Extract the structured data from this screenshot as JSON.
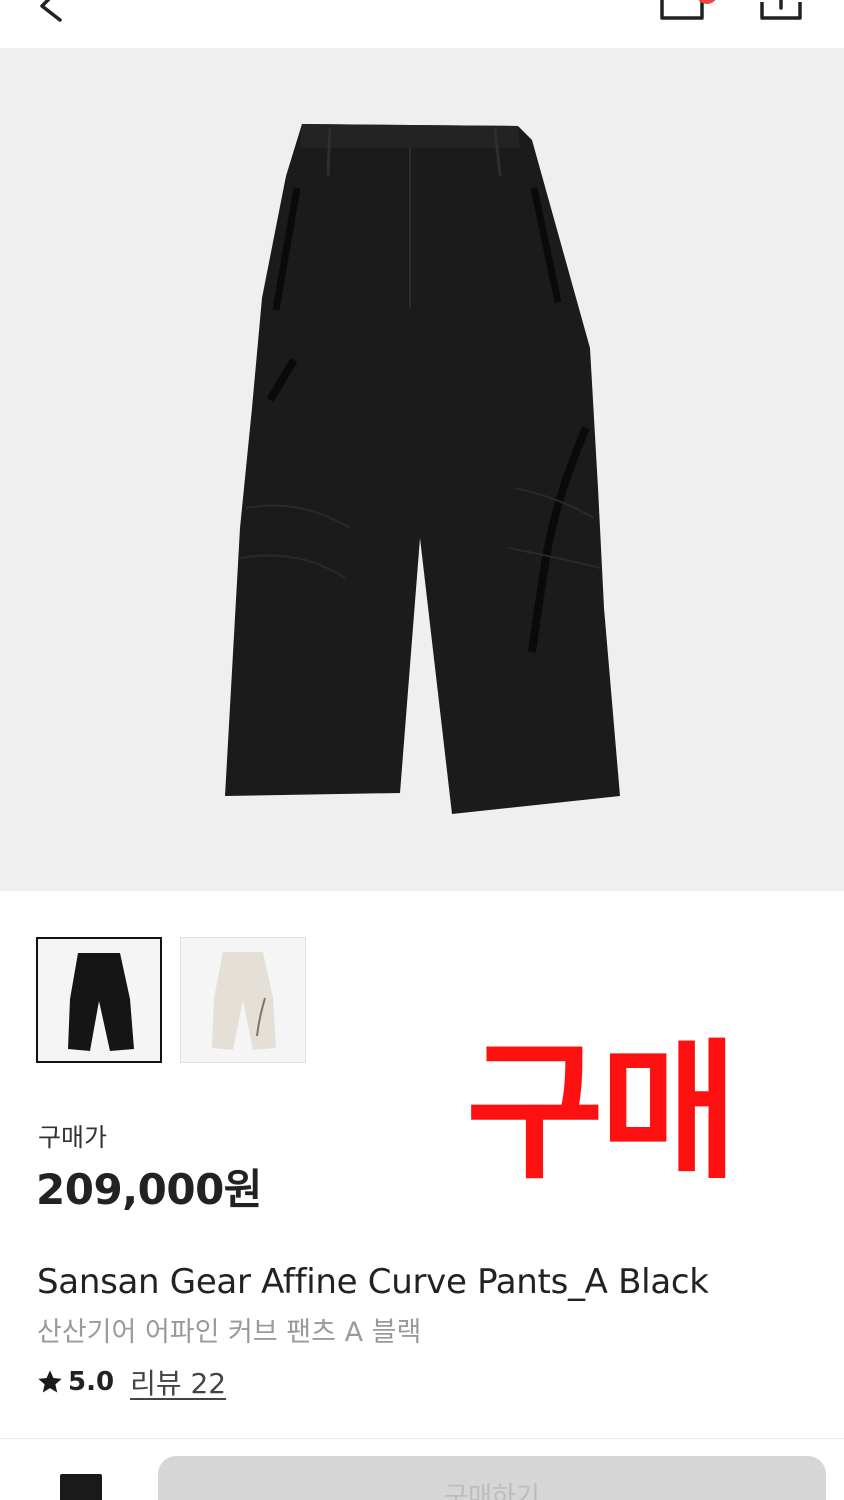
{
  "header": {
    "back_icon": "chevron-left-icon",
    "cart_icon": "shopping-bag-icon",
    "share_icon": "share-icon",
    "badge_color": "#ef4444"
  },
  "product": {
    "image": "black-pants",
    "thumbnails": [
      {
        "label": "black",
        "selected": true
      },
      {
        "label": "ivory",
        "selected": false
      }
    ],
    "price_label": "구매가",
    "price": "209,000원",
    "name_en": "Sansan Gear Affine Curve Pants_A Black",
    "name_kr": "산산기어 어파인 커브 팬츠 A 블랙",
    "rating": "5.0",
    "review_link": "리뷰 22"
  },
  "overlay": {
    "text": "구매",
    "color": "#ff1010"
  },
  "bottom": {
    "wishlist_icon": "bookmark-icon",
    "buy_button_label": "구매하기"
  }
}
